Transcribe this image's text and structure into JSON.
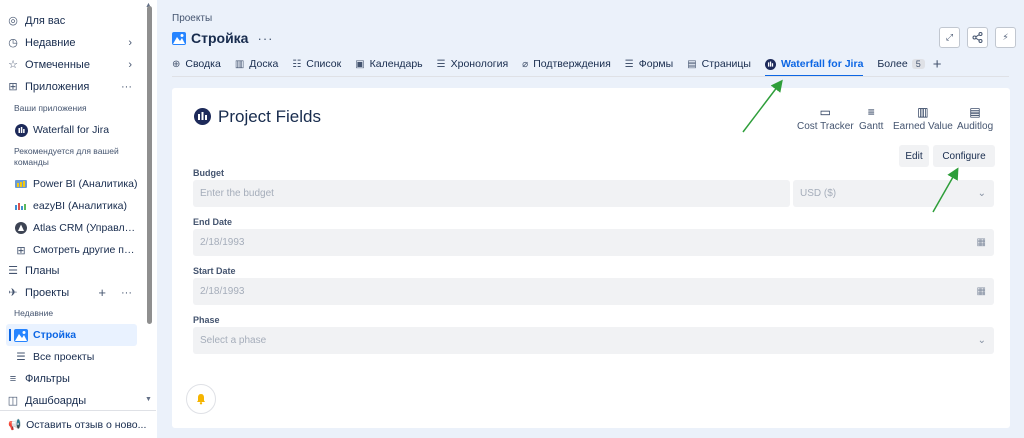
{
  "sidebar": {
    "for_you": "Для вас",
    "recent": "Недавние",
    "starred": "Отмеченные",
    "apps": "Приложения",
    "apps_more": "···",
    "your_apps": "Ваши приложения",
    "waterfall": "Waterfall for Jira",
    "recommended": "Рекомендуется для вашей команды",
    "power_bi": "Power BI (Аналитика)",
    "eazybi": "eazyBI (Аналитика)",
    "atlas_crm": "Atlas CRM (Управлен...",
    "explore_apps": "Смотреть другие при...",
    "plans": "Планы",
    "projects": "Проекты",
    "projects_add": "+",
    "projects_more": "···",
    "recent_sub": "Недавние",
    "current_project": "Стройка",
    "all_projects": "Все проекты",
    "filters": "Фильтры",
    "dashboards": "Дашбоарды",
    "feedback": "Оставить отзыв о ново..."
  },
  "header": {
    "breadcrumb": "Проекты",
    "project_name": "Стройка",
    "more": "···"
  },
  "tabs": [
    {
      "label": "Сводка",
      "icon": "globe-icon"
    },
    {
      "label": "Доска",
      "icon": "board-icon"
    },
    {
      "label": "Список",
      "icon": "list-icon"
    },
    {
      "label": "Календарь",
      "icon": "calendar-icon"
    },
    {
      "label": "Хронология",
      "icon": "timeline-icon"
    },
    {
      "label": "Подтверждения",
      "icon": "paperclip-icon"
    },
    {
      "label": "Формы",
      "icon": "form-icon"
    },
    {
      "label": "Страницы",
      "icon": "page-icon"
    },
    {
      "label": "Waterfall for Jira",
      "icon": "waterfall-icon",
      "active": true
    },
    {
      "label": "Более",
      "badge": "5"
    }
  ],
  "panel": {
    "title": "Project Fields",
    "tools": {
      "cost_tracker": "Cost Tracker",
      "gantt": "Gantt",
      "earned_value": "Earned Value",
      "auditlog": "Auditlog"
    },
    "edit": "Edit",
    "configure": "Configure",
    "fields": {
      "budget_label": "Budget",
      "budget_placeholder": "Enter the budget",
      "currency": "USD ($)",
      "end_label": "End Date",
      "end_value": "2/18/1993",
      "start_label": "Start Date",
      "start_value": "2/18/1993",
      "phase_label": "Phase",
      "phase_placeholder": "Select a phase"
    }
  },
  "colors": {
    "accent": "#0c66e4",
    "main_bg": "#ebf1fa",
    "arrow": "#2e9e3a"
  }
}
